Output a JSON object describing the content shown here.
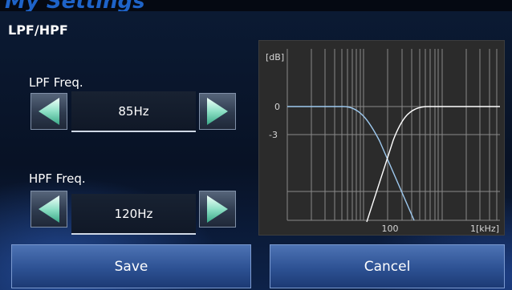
{
  "header": {
    "background_text": "My Settings"
  },
  "screen": {
    "title": "LPF/HPF"
  },
  "lpf": {
    "label": "LPF Freq.",
    "value": "85Hz"
  },
  "hpf": {
    "label": "HPF Freq.",
    "value": "120Hz"
  },
  "graph": {
    "unit_label": "[dB]",
    "y_ticks": [
      "0",
      "-3"
    ],
    "x_ticks": [
      "100",
      "1[kHz]"
    ],
    "colors": {
      "lpf_curve": "#9ec9ef",
      "hpf_curve": "#ffffff",
      "grid": "#8a8a8a"
    }
  },
  "buttons": {
    "save": "Save",
    "cancel": "Cancel"
  },
  "icons": {
    "left": "triangle-left-icon",
    "right": "triangle-right-icon"
  }
}
